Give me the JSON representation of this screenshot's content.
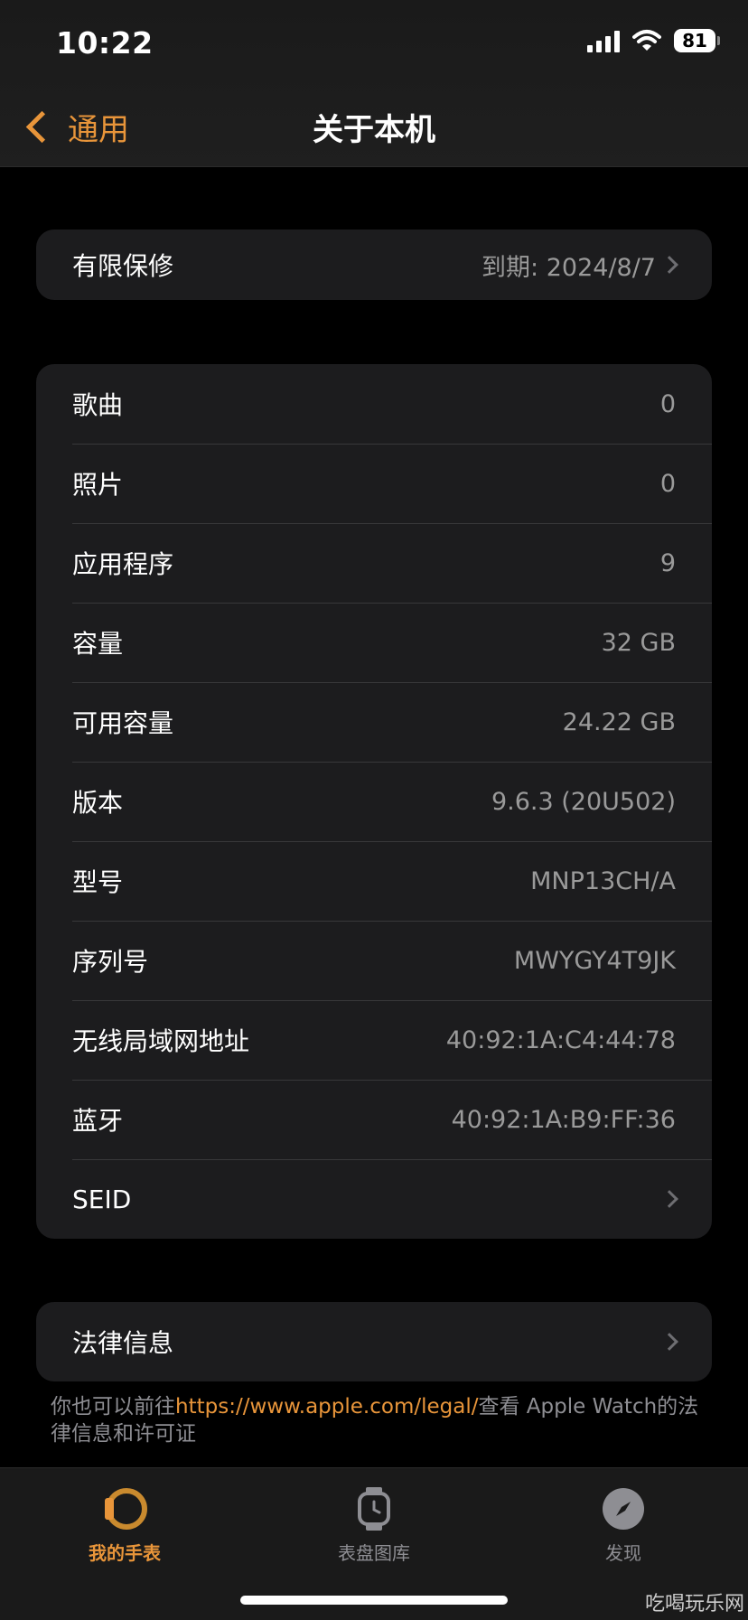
{
  "status": {
    "time": "10:22",
    "battery": "81"
  },
  "nav": {
    "back_label": "通用",
    "title": "关于本机"
  },
  "warranty": {
    "label": "有限保修",
    "value": "到期: 2024/8/7"
  },
  "info_rows": [
    {
      "label": "歌曲",
      "value": "0"
    },
    {
      "label": "照片",
      "value": "0"
    },
    {
      "label": "应用程序",
      "value": "9"
    },
    {
      "label": "容量",
      "value": "32 GB"
    },
    {
      "label": "可用容量",
      "value": "24.22 GB"
    },
    {
      "label": "版本",
      "value": "9.6.3 (20U502)"
    },
    {
      "label": "型号",
      "value": "MNP13CH/A"
    },
    {
      "label": "序列号",
      "value": "MWYGY4T9JK"
    },
    {
      "label": "无线局域网地址",
      "value": "40:92:1A:C4:44:78"
    },
    {
      "label": "蓝牙",
      "value": "40:92:1A:B9:FF:36"
    },
    {
      "label": "SEID",
      "value": ""
    }
  ],
  "legal": {
    "label": "法律信息"
  },
  "footnote": {
    "prefix": "你也可以前往",
    "link": "https://www.apple.com/legal/",
    "suffix": "查看 Apple Watch的法律信息和许可证"
  },
  "tabs": [
    {
      "label": "我的手表",
      "icon": "watch-face-icon",
      "active": true
    },
    {
      "label": "表盘图库",
      "icon": "watch-icon",
      "active": false
    },
    {
      "label": "发现",
      "icon": "compass-icon",
      "active": false
    }
  ],
  "watermark": "吃喝玩乐网",
  "colors": {
    "accent": "#e8953a",
    "background": "#000000",
    "group": "#1c1c1e"
  }
}
